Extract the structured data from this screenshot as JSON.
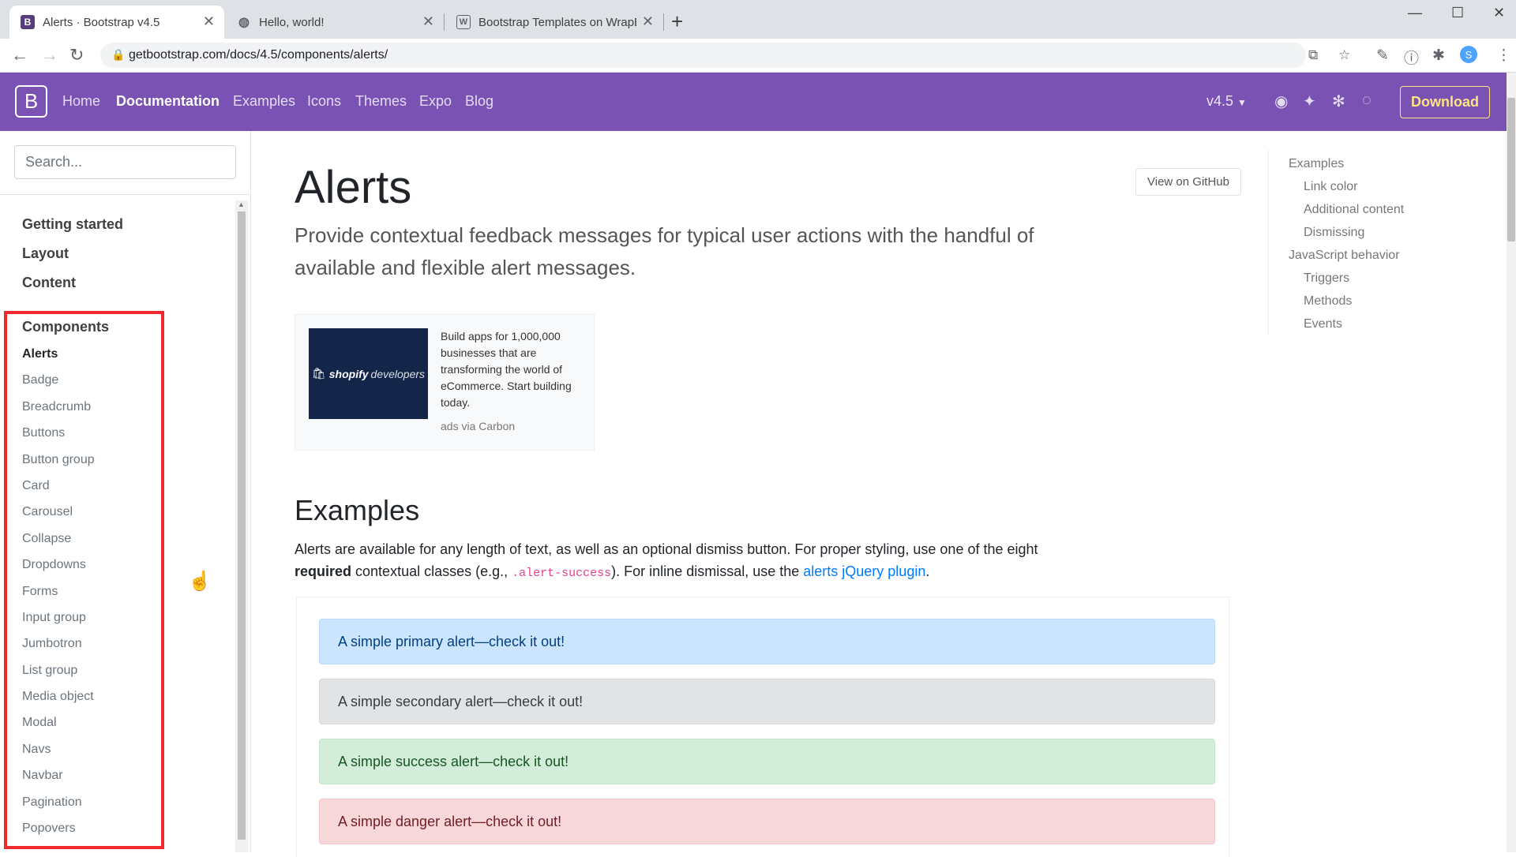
{
  "browser": {
    "tabs": [
      {
        "title": "Alerts · Bootstrap v4.5",
        "favicon": "B",
        "active": true
      },
      {
        "title": "Hello, world!",
        "favicon": "globe",
        "active": false
      },
      {
        "title": "Bootstrap Templates on WrapBootstrap",
        "favicon": "W",
        "active": false
      }
    ],
    "url": "getbootstrap.com/docs/4.5/components/alerts/"
  },
  "navbar": {
    "brand": "B",
    "links": [
      "Home",
      "Documentation",
      "Examples",
      "Icons",
      "Themes",
      "Expo",
      "Blog"
    ],
    "active_link": "Documentation",
    "version": "v4.5",
    "download": "Download",
    "brand_color": "#7952b3"
  },
  "sidebar": {
    "search_placeholder": "Search...",
    "groups": [
      "Getting started",
      "Layout",
      "Content",
      "Components"
    ],
    "components": [
      "Alerts",
      "Badge",
      "Breadcrumb",
      "Buttons",
      "Button group",
      "Card",
      "Carousel",
      "Collapse",
      "Dropdowns",
      "Forms",
      "Input group",
      "Jumbotron",
      "List group",
      "Media object",
      "Modal",
      "Navs",
      "Navbar",
      "Pagination",
      "Popovers"
    ],
    "active_component": "Alerts"
  },
  "main": {
    "title": "Alerts",
    "lead": "Provide contextual feedback messages for typical user actions with the handful of available and flexible alert messages.",
    "github_button": "View on GitHub",
    "carbon": {
      "image_brand": "shopify",
      "image_sub": "developers",
      "text": "Build apps for 1,000,000 businesses that are transforming the world of eCommerce. Start building today.",
      "via": "ads via Carbon"
    },
    "examples_heading": "Examples",
    "examples_para": {
      "part1": "Alerts are available for any length of text, as well as an optional dismiss button. For proper styling, use one of the eight ",
      "bold": "required",
      "part2": " contextual classes (e.g., ",
      "code": ".alert-success",
      "part3": "). For inline dismissal, use the ",
      "link": "alerts jQuery plugin",
      "part4": "."
    },
    "alerts": [
      "A simple primary alert—check it out!",
      "A simple secondary alert—check it out!",
      "A simple success alert—check it out!",
      "A simple danger alert—check it out!"
    ]
  },
  "toc": {
    "items": [
      "Examples",
      "Link color",
      "Additional content",
      "Dismissing",
      "JavaScript behavior",
      "Triggers",
      "Methods",
      "Events"
    ]
  }
}
